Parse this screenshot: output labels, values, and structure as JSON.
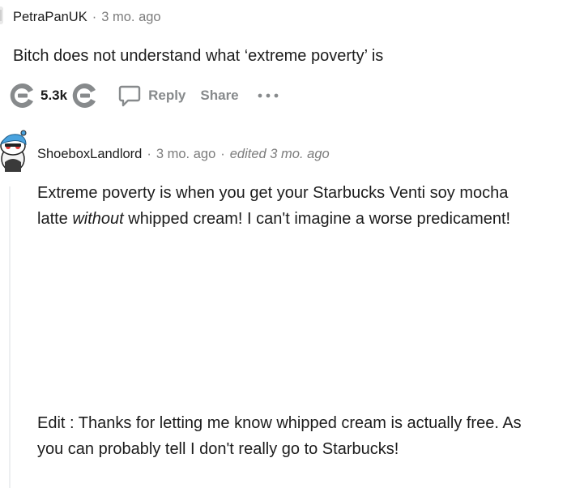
{
  "comment": {
    "username": "PetraPanUK",
    "separator": "·",
    "time": "3 mo. ago",
    "body": "Bitch does not understand what ‘extreme poverty’ is",
    "actions": {
      "vote_count": "5.3k",
      "reply_label": "Reply",
      "share_label": "Share",
      "more_label": "···"
    }
  },
  "reply": {
    "username": "ShoeboxLandlord",
    "separator": "·",
    "time": "3 mo. ago",
    "edited": "edited 3 mo. ago",
    "body_before_italic": "Extreme poverty is when you get your Starbucks Venti soy mocha latte ",
    "body_italic": "without",
    "body_after_italic": " whipped cream! I can't imagine a worse predicament!",
    "edit_note": "Edit : Thanks for letting me know whipped cream is actually free. As you can probably tell I don't really go to Starbucks!"
  },
  "icons": {
    "upvote": "upvote-icon",
    "downvote": "downvote-icon",
    "reply": "speech-bubble-icon",
    "more": "more-dots-icon"
  },
  "colors": {
    "meta_gray": "#7c7c7c",
    "action_gray": "#878a8c",
    "text": "#1c1c1c",
    "thread_line": "#edeff1"
  }
}
